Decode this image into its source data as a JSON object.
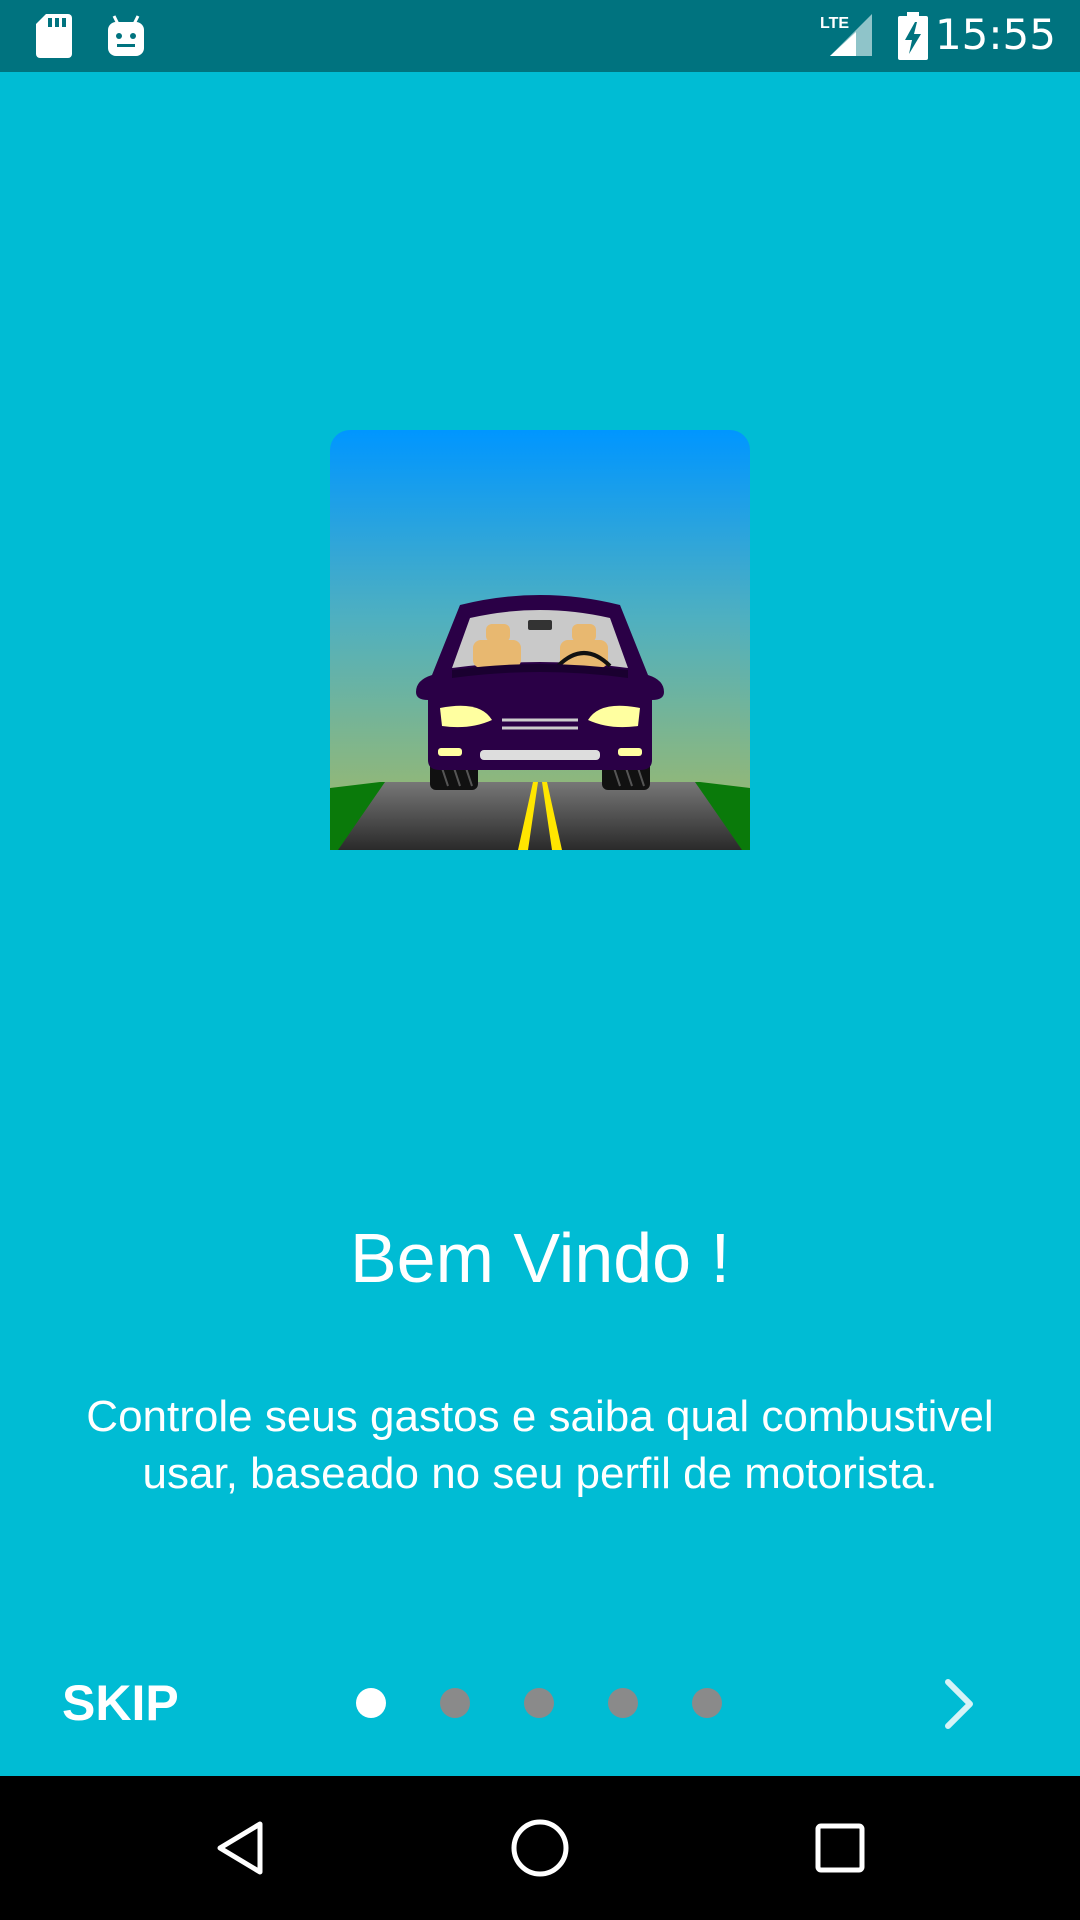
{
  "status_bar": {
    "time": "15:55",
    "network": "LTE",
    "left_icons": [
      "sd-card-icon",
      "android-icon"
    ],
    "right_icons": [
      "lte-signal-icon",
      "battery-charging-icon"
    ]
  },
  "slide": {
    "illustration": "car-on-road-illustration",
    "title": "Bem Vindo !",
    "description": "Controle seus gastos e saiba qual combustivel usar, baseado no seu perfil de motorista."
  },
  "pager": {
    "skip_label": "SKIP",
    "total_pages": 5,
    "current_page": 1,
    "next_icon": "chevron-right-icon"
  },
  "nav_bar": {
    "buttons": [
      "back-icon",
      "home-icon",
      "recents-icon"
    ]
  },
  "colors": {
    "background": "#00BCD4",
    "status_bar": "#00737F",
    "dot_active": "#FFFFFF",
    "dot_inactive": "#8A8A8A"
  }
}
